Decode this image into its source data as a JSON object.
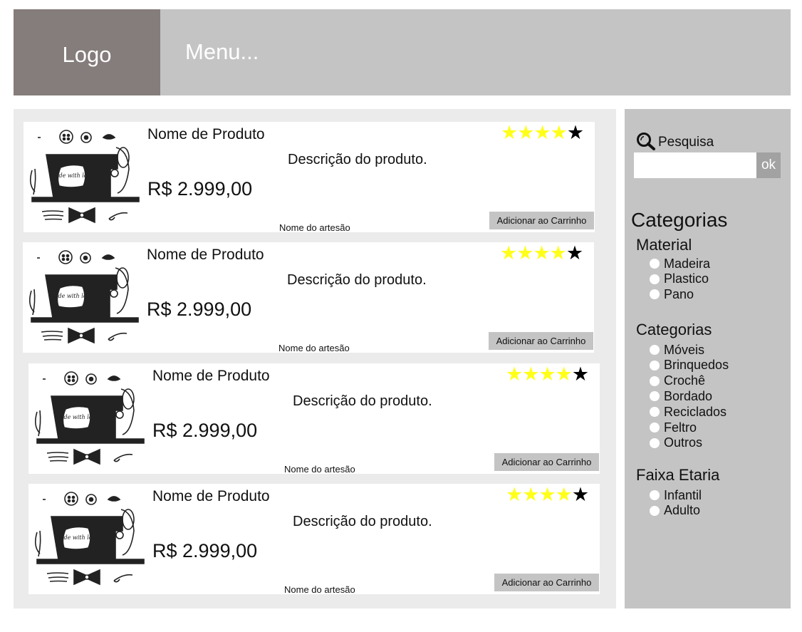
{
  "header": {
    "logo": "Logo",
    "menu": "Menu..."
  },
  "products": [
    {
      "name": "Nome de Produto",
      "description": "Descrição do produto.",
      "price": "R$ 2.999,00",
      "artisan": "Nome do artesão",
      "rating": 4,
      "max_rating": 5,
      "cart_label": "Adicionar ao Carrinho",
      "image_text": "made with love"
    },
    {
      "name": "Nome de Produto",
      "description": "Descrição do produto.",
      "price": "R$ 2.999,00",
      "artisan": "Nome do artesão",
      "rating": 4,
      "max_rating": 5,
      "cart_label": "Adicionar ao Carrinho",
      "image_text": "made with love"
    },
    {
      "name": "Nome de Produto",
      "description": "Descrição do produto.",
      "price": "R$ 2.999,00",
      "artisan": "Nome do artesão",
      "rating": 4,
      "max_rating": 5,
      "cart_label": "Adicionar ao Carrinho",
      "image_text": "made with love"
    },
    {
      "name": "Nome de Produto",
      "description": "Descrição do produto.",
      "price": "R$ 2.999,00",
      "artisan": "Nome do artesão",
      "rating": 4,
      "max_rating": 5,
      "cart_label": "Adicionar ao Carrinho",
      "image_text": "made with love"
    }
  ],
  "sidebar": {
    "search_label": "Pesquisa",
    "search_icon": "search-icon",
    "ok_label": "ok",
    "categories_title": "Categorias",
    "groups": [
      {
        "title": "Material",
        "options": [
          "Madeira",
          "Plastico",
          "Pano"
        ]
      },
      {
        "title": "Categorias",
        "options": [
          "Móveis",
          "Brinquedos",
          "Crochê",
          "Bordado",
          "Reciclados",
          "Feltro",
          "Outros"
        ]
      },
      {
        "title": "Faixa Etaria",
        "options": [
          "Infantil",
          "Adulto"
        ]
      }
    ]
  },
  "colors": {
    "header": "#c4c4c4",
    "logo": "#857d7b",
    "star_on": "#ffff19",
    "star_off": "#000000",
    "panel": "#ebebeb"
  }
}
